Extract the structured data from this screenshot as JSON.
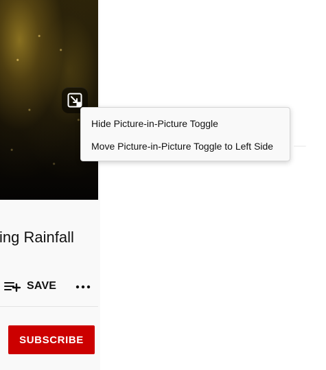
{
  "page": {
    "video_title_visible_fragment": "ing Rainfall"
  },
  "video_actions": {
    "save_label": "SAVE"
  },
  "channel": {
    "subscribe_label": "SUBSCRIBE"
  },
  "context_menu": {
    "items": [
      {
        "text": "Hide Picture-in-Picture Toggle"
      },
      {
        "text": "Move Picture-in-Picture Toggle to Left Side"
      }
    ]
  },
  "icons": {
    "pip_toggle": "picture-in-picture-icon",
    "save": "playlist-add-icon",
    "more": "more-horizontal-icon"
  },
  "colors": {
    "subscribe_bg": "#cc0000"
  }
}
